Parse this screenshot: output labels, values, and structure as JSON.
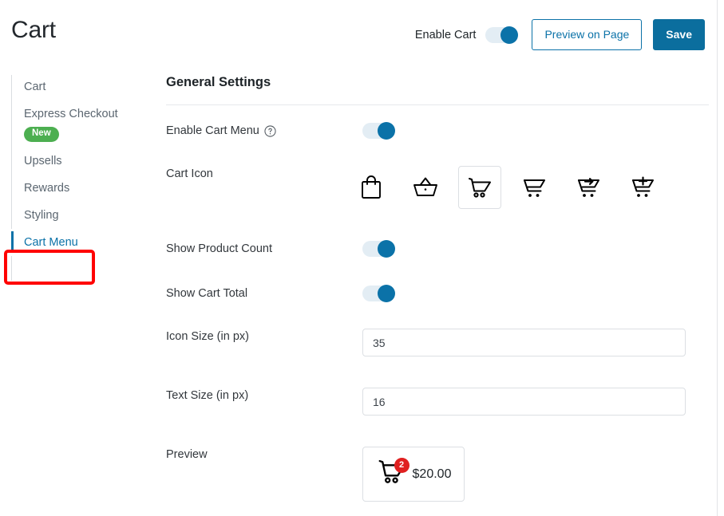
{
  "header": {
    "title": "Cart",
    "enable_cart_label": "Enable Cart",
    "enable_cart_on": true,
    "preview_button": "Preview on Page",
    "save_button": "Save",
    "accent_color": "#0b72a8",
    "primary_button_color": "#0b6e9e"
  },
  "sidebar": {
    "items": [
      {
        "label": "Cart",
        "active": false,
        "badge": null
      },
      {
        "label": "Express Checkout",
        "active": false,
        "badge": "New"
      },
      {
        "label": "Upsells",
        "active": false,
        "badge": null
      },
      {
        "label": "Rewards",
        "active": false,
        "badge": null
      },
      {
        "label": "Styling",
        "active": false,
        "badge": null
      },
      {
        "label": "Cart Menu",
        "active": true,
        "badge": null
      }
    ],
    "badge_color": "#4caf50",
    "annotation_color": "#ff0000"
  },
  "main": {
    "section_title": "General Settings",
    "rows": {
      "enable_cart_menu": {
        "label": "Enable Cart Menu",
        "help_icon": "question-circle-icon",
        "value_on": true
      },
      "cart_icon": {
        "label": "Cart Icon",
        "selected_index": 2,
        "options": [
          "shopping-bag-icon",
          "shopping-basket-icon",
          "shopping-cart-icon",
          "cart-outline-icon",
          "cart-arrow-icon",
          "cart-plus-icon"
        ]
      },
      "show_product_count": {
        "label": "Show Product Count",
        "value_on": true
      },
      "show_cart_total": {
        "label": "Show Cart Total",
        "value_on": true
      },
      "icon_size": {
        "label": "Icon Size (in px)",
        "value": "35",
        "placeholder": ""
      },
      "text_size": {
        "label": "Text Size (in px)",
        "value": "16",
        "placeholder": ""
      },
      "preview": {
        "label": "Preview",
        "badge_count": "2",
        "total": "$20.00",
        "badge_color": "#e02020"
      }
    }
  }
}
